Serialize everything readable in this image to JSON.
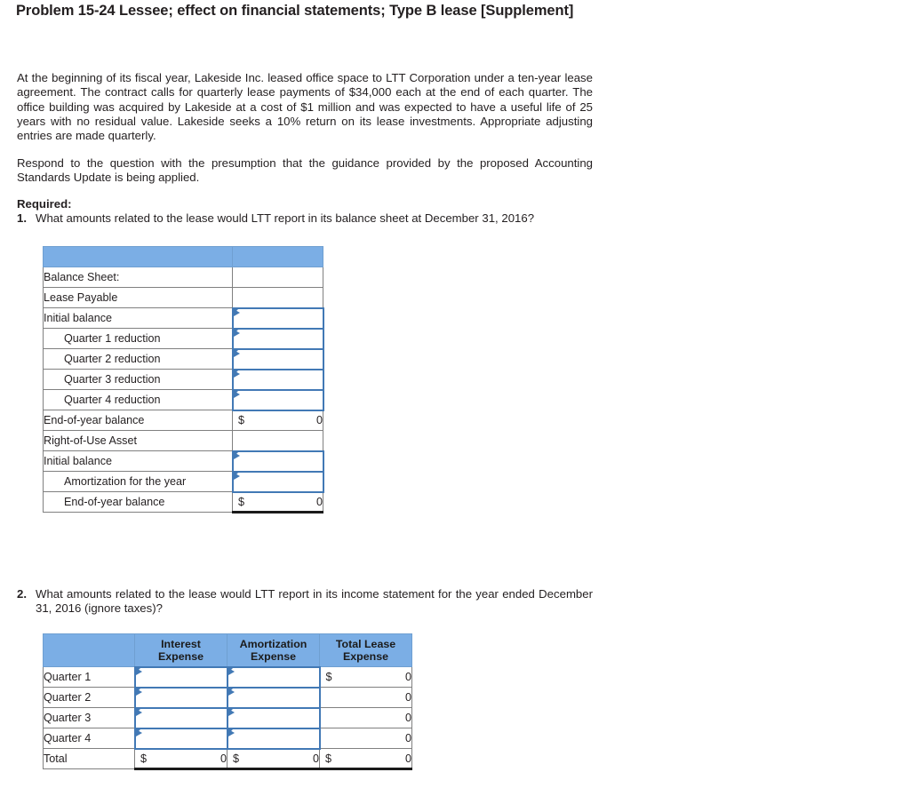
{
  "page": {
    "title": "Problem 15-24 Lessee; effect on financial statements; Type B lease [Supplement]",
    "paragraph1": "At the beginning of its fiscal year, Lakeside Inc. leased office space to LTT Corporation under a ten-year lease agreement. The contract calls for quarterly lease payments of $34,000 each at the end of each quarter. The office building was acquired by Lakeside at a cost of $1 million and was expected to have a useful life of 25 years with no residual value. Lakeside seeks a 10% return on its lease investments. Appropriate adjusting entries are made quarterly.",
    "paragraph2": "Respond to the question with the presumption that the guidance provided by the proposed Accounting Standards Update is being applied.",
    "required_label": "Required:",
    "question1_num": "1.",
    "question1_text": "What amounts related to the lease would LTT report in its balance sheet at December 31, 2016?",
    "question2_num": "2.",
    "question2_text": "What amounts related to the lease would LTT report in its income statement for the year ended December 31, 2016 (ignore taxes)?"
  },
  "colors": {
    "header_blue": "#7BAEE5",
    "input_border_blue": "#4279B5",
    "grid_gray": "#808080",
    "text": "#231f20"
  },
  "table_balance_sheet": {
    "name": "Balance Sheet table",
    "header_blank": "",
    "rows": [
      {
        "label": "Balance Sheet:",
        "indent": false,
        "value_type": "blank",
        "currency": "",
        "value": ""
      },
      {
        "label": "Lease Payable",
        "indent": false,
        "value_type": "blank",
        "currency": "",
        "value": ""
      },
      {
        "label": "Initial balance",
        "indent": false,
        "value_type": "input",
        "currency": "",
        "value": ""
      },
      {
        "label": "Quarter 1 reduction",
        "indent": true,
        "value_type": "input",
        "currency": "",
        "value": ""
      },
      {
        "label": "Quarter 2 reduction",
        "indent": true,
        "value_type": "input",
        "currency": "",
        "value": ""
      },
      {
        "label": "Quarter 3 reduction",
        "indent": true,
        "value_type": "input",
        "currency": "",
        "value": ""
      },
      {
        "label": "Quarter 4 reduction",
        "indent": true,
        "value_type": "input",
        "currency": "",
        "value": ""
      },
      {
        "label": "End-of-year balance",
        "indent": false,
        "value_type": "computed",
        "currency": "$",
        "value": "0"
      },
      {
        "label": "Right-of-Use Asset",
        "indent": false,
        "value_type": "blank",
        "currency": "",
        "value": ""
      },
      {
        "label": "Initial balance",
        "indent": false,
        "value_type": "input",
        "currency": "",
        "value": ""
      },
      {
        "label": "Amortization for the year",
        "indent": true,
        "value_type": "input",
        "currency": "",
        "value": ""
      },
      {
        "label": "End-of-year balance",
        "indent": true,
        "value_type": "total",
        "currency": "$",
        "value": "0"
      }
    ]
  },
  "table_income_statement": {
    "name": "Income Statement table",
    "corner_blank": "",
    "columns": [
      {
        "line1": "Interest",
        "line2": "Expense"
      },
      {
        "line1": "Amortization",
        "line2": "Expense"
      },
      {
        "line1": "Total Lease",
        "line2": "Expense"
      }
    ],
    "rows": [
      {
        "label": "Quarter 1",
        "cells": [
          {
            "type": "input",
            "currency": "",
            "value": ""
          },
          {
            "type": "input",
            "currency": "",
            "value": ""
          },
          {
            "type": "computed",
            "currency": "$",
            "value": "0"
          }
        ]
      },
      {
        "label": "Quarter 2",
        "cells": [
          {
            "type": "input",
            "currency": "",
            "value": ""
          },
          {
            "type": "input",
            "currency": "",
            "value": ""
          },
          {
            "type": "computed",
            "currency": "",
            "value": "0"
          }
        ]
      },
      {
        "label": "Quarter 3",
        "cells": [
          {
            "type": "input",
            "currency": "",
            "value": ""
          },
          {
            "type": "input",
            "currency": "",
            "value": ""
          },
          {
            "type": "computed",
            "currency": "",
            "value": "0"
          }
        ]
      },
      {
        "label": "Quarter 4",
        "cells": [
          {
            "type": "input",
            "currency": "",
            "value": ""
          },
          {
            "type": "input",
            "currency": "",
            "value": ""
          },
          {
            "type": "computed",
            "currency": "",
            "value": "0"
          }
        ]
      },
      {
        "label": "Total",
        "cells": [
          {
            "type": "total",
            "currency": "$",
            "value": "0"
          },
          {
            "type": "total",
            "currency": "$",
            "value": "0"
          },
          {
            "type": "total",
            "currency": "$",
            "value": "0"
          }
        ]
      }
    ]
  }
}
